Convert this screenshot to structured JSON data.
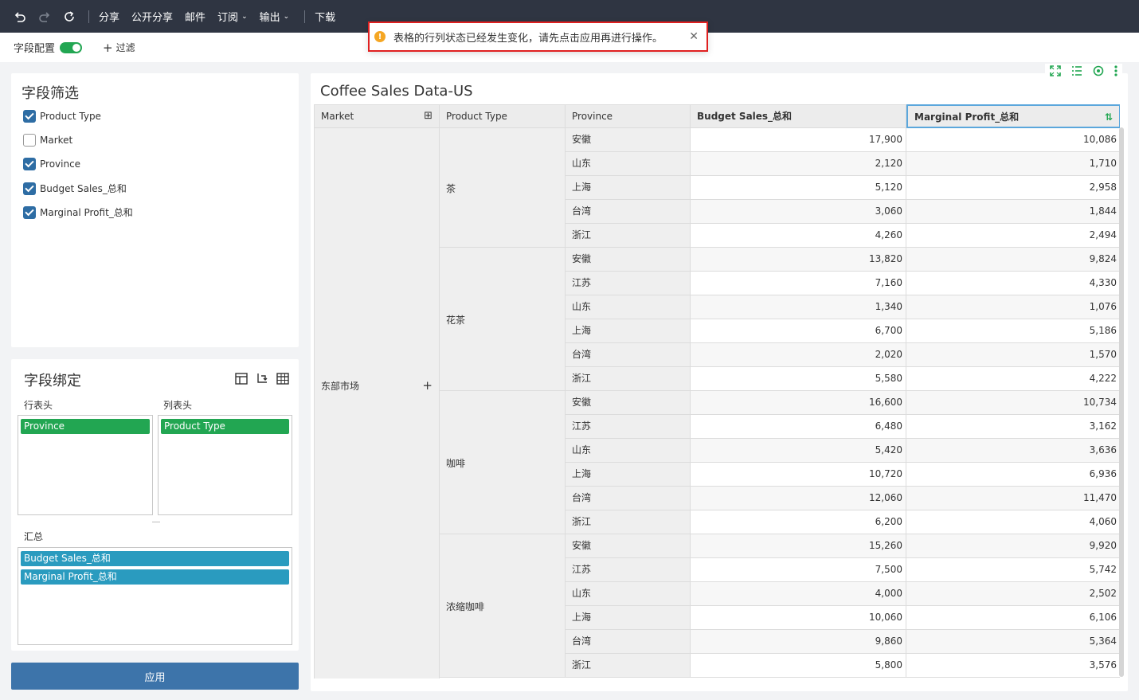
{
  "toolbar": {
    "share": "分享",
    "public_share": "公开分享",
    "mail": "邮件",
    "subscribe": "订阅",
    "export": "输出",
    "download": "下载"
  },
  "subbar": {
    "field_config": "字段配置",
    "filter": "过滤"
  },
  "toast": {
    "message": "表格的行列状态已经发生变化，请先点击应用再进行操作。"
  },
  "field_filter": {
    "title": "字段筛选",
    "items": [
      {
        "label": "Product Type",
        "checked": true
      },
      {
        "label": "Market",
        "checked": false
      },
      {
        "label": "Province",
        "checked": true
      },
      {
        "label": "Budget Sales_总和",
        "checked": true
      },
      {
        "label": "Marginal Profit_总和",
        "checked": true
      }
    ]
  },
  "field_binding": {
    "title": "字段绑定",
    "row_header_label": "行表头",
    "col_header_label": "列表头",
    "row_fields": [
      "Province"
    ],
    "col_fields": [
      "Product Type"
    ],
    "summary_label": "汇总",
    "summary_fields": [
      "Budget Sales_总和",
      "Marginal Profit_总和"
    ]
  },
  "apply_button": "应用",
  "colors": {
    "accent_green": "#22a652",
    "accent_teal": "#2a9bbf",
    "apply_blue": "#3d74aa",
    "topbar": "#2f3542",
    "alert_red": "#e02020"
  },
  "table": {
    "title": "Coffee Sales Data-US",
    "headers": [
      "Market",
      "Product Type",
      "Province",
      "Budget Sales_总和",
      "Marginal Profit_总和"
    ],
    "market": "东部市场",
    "groups": [
      {
        "product": "茶",
        "rows": [
          [
            "安徽",
            "17,900",
            "10,086"
          ],
          [
            "山东",
            "2,120",
            "1,710"
          ],
          [
            "上海",
            "5,120",
            "2,958"
          ],
          [
            "台湾",
            "3,060",
            "1,844"
          ],
          [
            "浙江",
            "4,260",
            "2,494"
          ]
        ]
      },
      {
        "product": "花茶",
        "rows": [
          [
            "安徽",
            "13,820",
            "9,824"
          ],
          [
            "江苏",
            "7,160",
            "4,330"
          ],
          [
            "山东",
            "1,340",
            "1,076"
          ],
          [
            "上海",
            "6,700",
            "5,186"
          ],
          [
            "台湾",
            "2,020",
            "1,570"
          ],
          [
            "浙江",
            "5,580",
            "4,222"
          ]
        ]
      },
      {
        "product": "咖啡",
        "rows": [
          [
            "安徽",
            "16,600",
            "10,734"
          ],
          [
            "江苏",
            "6,480",
            "3,162"
          ],
          [
            "山东",
            "5,420",
            "3,636"
          ],
          [
            "上海",
            "10,720",
            "6,936"
          ],
          [
            "台湾",
            "12,060",
            "11,470"
          ],
          [
            "浙江",
            "6,200",
            "4,060"
          ]
        ]
      },
      {
        "product": "浓缩咖啡",
        "rows": [
          [
            "安徽",
            "15,260",
            "9,920"
          ],
          [
            "江苏",
            "7,500",
            "5,742"
          ],
          [
            "山东",
            "4,000",
            "2,502"
          ],
          [
            "上海",
            "10,060",
            "6,106"
          ],
          [
            "台湾",
            "9,860",
            "5,364"
          ],
          [
            "浙江",
            "5,800",
            "3,576"
          ]
        ]
      }
    ]
  }
}
